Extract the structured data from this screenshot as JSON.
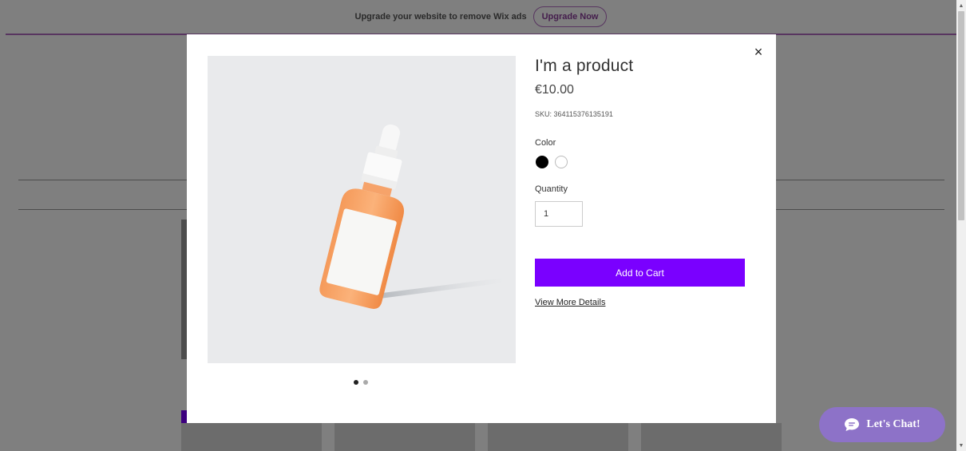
{
  "banner": {
    "text": "Upgrade your website to remove Wix ads",
    "button_label": "Upgrade Now"
  },
  "modal": {
    "close_icon": "×",
    "product": {
      "title": "I'm a product",
      "price": "€10.00",
      "sku": "SKU: 364115376135191",
      "color_label": "Color",
      "colors": [
        "black",
        "white"
      ],
      "quantity_label": "Quantity",
      "quantity_value": "1",
      "add_to_cart_label": "Add to Cart",
      "view_details_label": "View More Details"
    },
    "image_dots": 2,
    "active_dot": 0
  },
  "chat": {
    "label": "Let's Chat!",
    "icon": "chat-bubble-icon"
  },
  "colors": {
    "accent": "#7a00ff",
    "chat": "#8d72c8",
    "banner_border": "#b06ac0"
  }
}
